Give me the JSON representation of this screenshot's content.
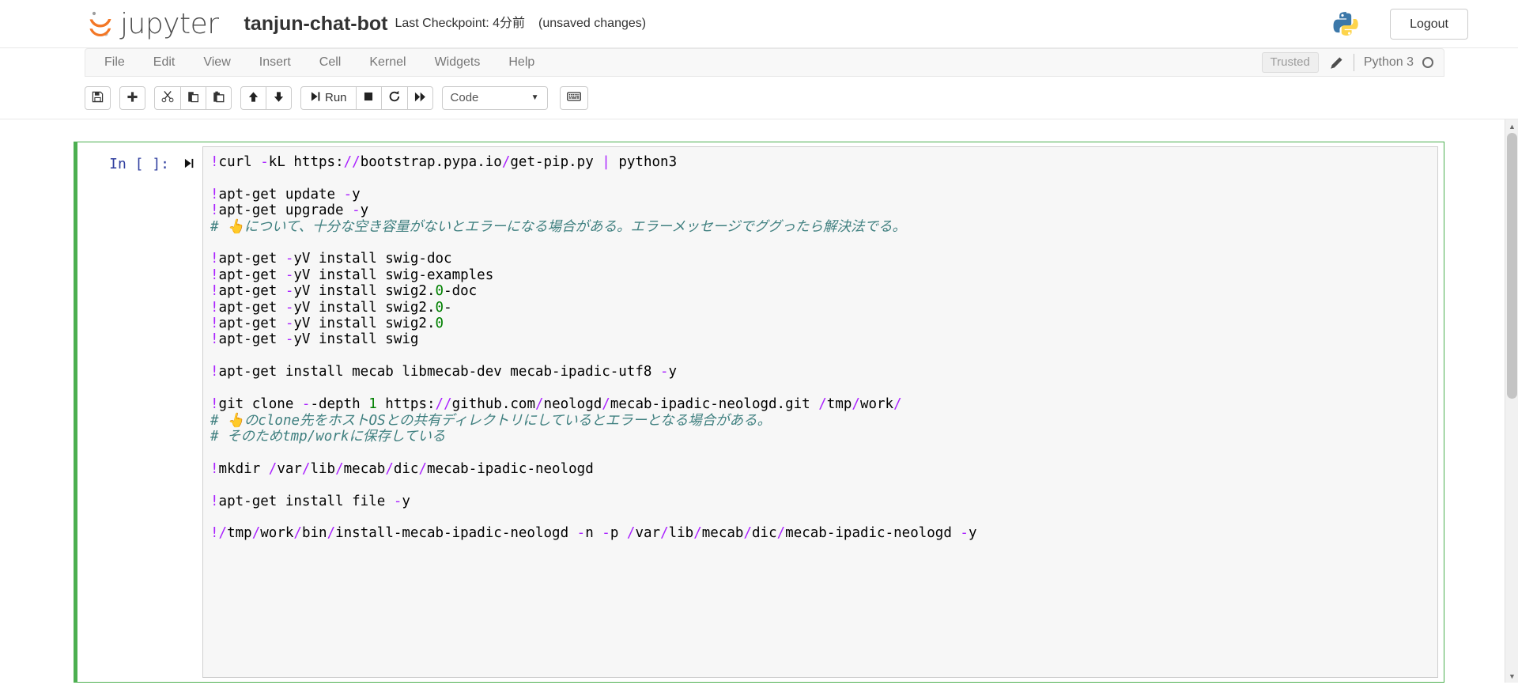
{
  "header": {
    "logo_word": "jupyter",
    "logo_icon": "jupyter-logo-icon",
    "notebook_name": "tanjun-chat-bot",
    "checkpoint": "Last Checkpoint: 4分前",
    "unsaved": "(unsaved changes)",
    "python_logo_icon": "python-logo-icon",
    "logout_label": "Logout"
  },
  "menubar": {
    "items": [
      {
        "label": "File"
      },
      {
        "label": "Edit"
      },
      {
        "label": "View"
      },
      {
        "label": "Insert"
      },
      {
        "label": "Cell"
      },
      {
        "label": "Kernel"
      },
      {
        "label": "Widgets"
      },
      {
        "label": "Help"
      }
    ],
    "trusted_label": "Trusted",
    "edit_icon": "pencil-icon",
    "kernel_name": "Python 3",
    "kernel_status_icon": "kernel-idle-circle-icon"
  },
  "toolbar": {
    "save_label": "save-icon",
    "insert_below_label": "plus-icon",
    "cut_label": "scissors-icon",
    "copy_label": "copy-icon",
    "paste_label": "paste-icon",
    "move_up_label": "arrow-up-icon",
    "move_down_label": "arrow-down-icon",
    "run_label": "Run",
    "run_icon": "run-step-icon",
    "stop_label": "stop-square-icon",
    "restart_label": "restart-circular-arrow-icon",
    "restart_run_all_label": "fast-forward-icon",
    "cell_type_value": "Code",
    "cell_type_caret": "▼",
    "command_palette_label": "keyboard-icon"
  },
  "cell": {
    "prompt": "In [ ]:",
    "run_marker": "▶|",
    "cell_type": "code",
    "source_lines": [
      {
        "t": "code",
        "text": "!curl -kL https://bootstrap.pypa.io/get-pip.py | python3"
      },
      {
        "t": "blank",
        "text": ""
      },
      {
        "t": "code",
        "text": "!apt-get update -y"
      },
      {
        "t": "code",
        "text": "!apt-get upgrade -y"
      },
      {
        "t": "comment",
        "text": "# 👆について、十分な空き容量がないとエラーになる場合がある。エラーメッセージでググったら解決法でる。"
      },
      {
        "t": "blank",
        "text": ""
      },
      {
        "t": "code",
        "text": "!apt-get -yV install swig-doc"
      },
      {
        "t": "code",
        "text": "!apt-get -yV install swig-examples"
      },
      {
        "t": "code",
        "text": "!apt-get -yV install swig2.0-doc"
      },
      {
        "t": "code",
        "text": "!apt-get -yV install swig2.0-"
      },
      {
        "t": "code",
        "text": "!apt-get -yV install swig2.0"
      },
      {
        "t": "code",
        "text": "!apt-get -yV install swig"
      },
      {
        "t": "blank",
        "text": ""
      },
      {
        "t": "code",
        "text": "!apt-get install mecab libmecab-dev mecab-ipadic-utf8 -y"
      },
      {
        "t": "blank",
        "text": ""
      },
      {
        "t": "code",
        "text": "!git clone --depth 1 https://github.com/neologd/mecab-ipadic-neologd.git /tmp/work/"
      },
      {
        "t": "comment",
        "text": "# 👆のclone先をホストOSとの共有ディレクトリにしているとエラーとなる場合がある。"
      },
      {
        "t": "comment",
        "text": "# そのためtmp/workに保存している"
      },
      {
        "t": "blank",
        "text": ""
      },
      {
        "t": "code",
        "text": "!mkdir /var/lib/mecab/dic/mecab-ipadic-neologd"
      },
      {
        "t": "blank",
        "text": ""
      },
      {
        "t": "code",
        "text": "!apt-get install file -y"
      },
      {
        "t": "blank",
        "text": ""
      },
      {
        "t": "code",
        "text": "!/tmp/work/bin/install-mecab-ipadic-neologd -n -p /var/lib/mecab/dic/mecab-ipadic-neologd -y"
      }
    ]
  },
  "scrollbar": {
    "up_arrow": "▲",
    "down_arrow": "▼"
  },
  "colors": {
    "cell_selected_border": "#4caf50",
    "prompt_blue": "#303f9f",
    "operator_purple": "#aa22ff",
    "number_green": "#008000",
    "comment_teal": "#408080",
    "jupyter_orange": "#f37726"
  }
}
